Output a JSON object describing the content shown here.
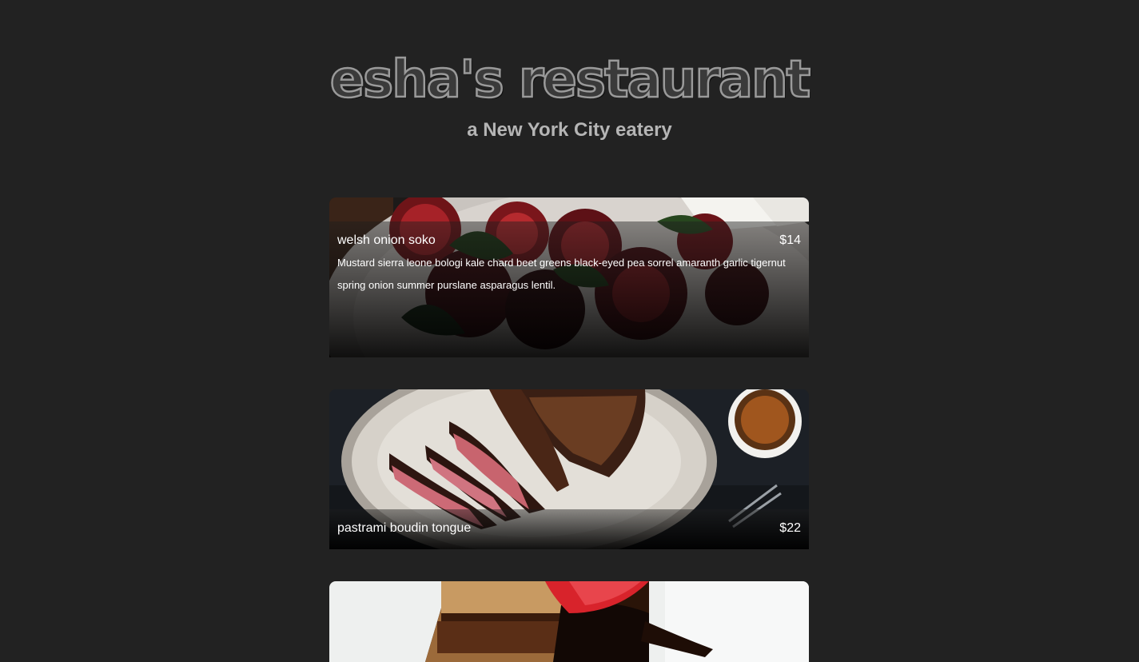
{
  "header": {
    "title": "esha's restaurant",
    "subtitle": "a New York City eatery"
  },
  "menu": [
    {
      "name": "welsh onion soko",
      "price": "$14",
      "description": "Mustard sierra leone bologi kale chard beet greens black-eyed pea sorrel amaranth garlic tigernut spring onion summer purslane asparagus lentil.",
      "photo": "beet-salad-photo"
    },
    {
      "name": "pastrami boudin tongue",
      "price": "$22",
      "photo": "sliced-steak-photo"
    },
    {
      "photo": "chocolate-cake-photo"
    }
  ],
  "colors": {
    "background": "#222222",
    "title_outline": "#9a9a9a",
    "subtitle": "#b5b5b5",
    "text": "#ffffff"
  }
}
